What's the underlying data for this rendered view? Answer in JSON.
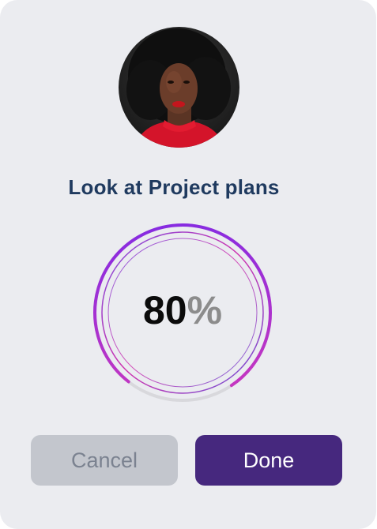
{
  "task": {
    "title": "Look at Project plans"
  },
  "progress": {
    "value": 80,
    "number_text": "80",
    "unit_text": "%"
  },
  "buttons": {
    "cancel_label": "Cancel",
    "done_label": "Done"
  },
  "colors": {
    "card_background": "#ebecf0",
    "title_text": "#1f3a5f",
    "done_button": "#46287e",
    "cancel_button": "#c3c6cd",
    "ring_gradient_start": "#7a28e8",
    "ring_gradient_end": "#d63ab8",
    "ring_track": "#d8d8dc"
  }
}
